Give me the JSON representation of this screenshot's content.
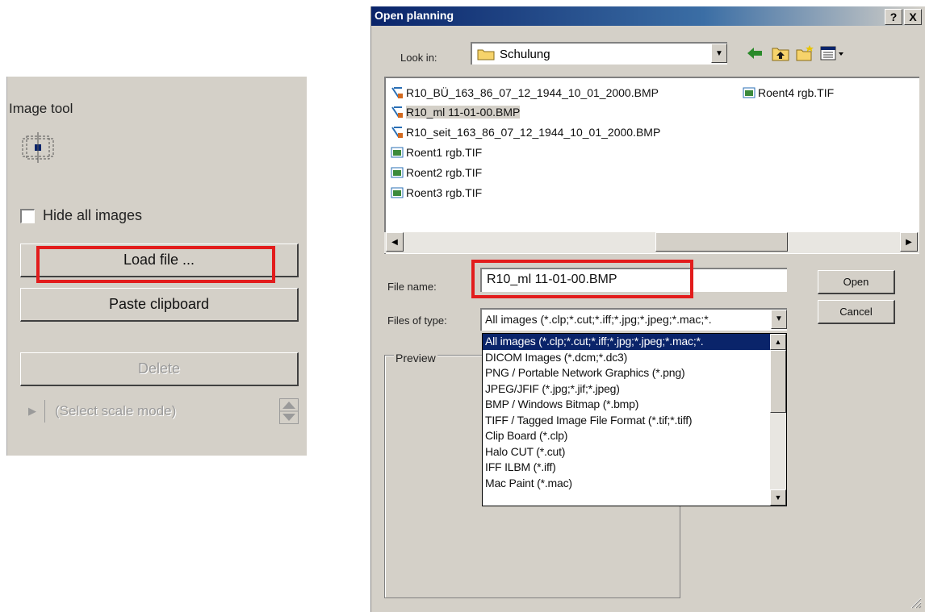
{
  "left_panel": {
    "title": "Image tool",
    "hide_images_label": "Hide all images",
    "load_file_label": "Load file ...",
    "paste_clipboard_label": "Paste clipboard",
    "delete_label": "Delete",
    "scale_mode_label": "(Select scale mode)"
  },
  "dialog": {
    "title": "Open planning",
    "help_label": "?",
    "close_label": "X",
    "look_in_label": "Look in:",
    "look_in_value": "Schulung",
    "files": [
      {
        "name": "R10_BÜ_163_86_07_12_1944_10_01_2000.BMP",
        "type": "bmp"
      },
      {
        "name": "R10_ml 11-01-00.BMP",
        "type": "bmp",
        "selected": true
      },
      {
        "name": "R10_seit_163_86_07_12_1944_10_01_2000.BMP",
        "type": "bmp"
      },
      {
        "name": "Roent1 rgb.TIF",
        "type": "tif"
      },
      {
        "name": "Roent2 rgb.TIF",
        "type": "tif"
      },
      {
        "name": "Roent3 rgb.TIF",
        "type": "tif"
      },
      {
        "name": "Roent4 rgb.TIF",
        "type": "tif"
      }
    ],
    "file_name_label": "File name:",
    "file_name_value": "R10_ml 11-01-00.BMP",
    "files_of_type_label": "Files of type:",
    "files_of_type_value": "All images (*.clp;*.cut;*.iff;*.jpg;*.jpeg;*.mac;*.",
    "open_label": "Open",
    "cancel_label": "Cancel",
    "preview_label": "Preview",
    "type_options": [
      "All images (*.clp;*.cut;*.iff;*.jpg;*.jpeg;*.mac;*.",
      "DICOM Images (*.dcm;*.dc3)",
      "PNG / Portable Network Graphics  (*.png)",
      "JPEG/JFIF  (*.jpg;*.jif;*.jpeg)",
      "BMP / Windows Bitmap  (*.bmp)",
      "TIFF / Tagged Image File Format  (*.tif;*.tiff)",
      "Clip Board  (*.clp)",
      "Halo CUT  (*.cut)",
      "IFF ILBM  (*.iff)",
      "Mac Paint  (*.mac)"
    ]
  },
  "colors": {
    "highlight": "#e21c1c",
    "selection": "#0a246a",
    "face": "#d4d0c8"
  }
}
